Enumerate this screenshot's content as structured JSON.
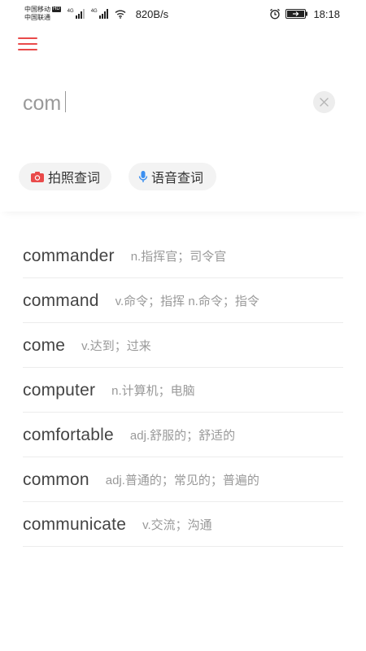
{
  "status_bar": {
    "carrier_1": "中国移动",
    "carrier_2": "中国联通",
    "hd_badge": "HD",
    "network_tag_1": "4G",
    "network_tag_2": "4G",
    "net_speed": "820B/s",
    "alarm_icon": "alarm-clock-icon",
    "battery_icon": "battery-icon",
    "time": "18:18"
  },
  "header": {
    "menu_icon": "hamburger-menu-icon",
    "menu_color": "#e94a4a"
  },
  "search": {
    "value": "com",
    "clear_icon": "clear-x-icon"
  },
  "actions": {
    "photo_label": "拍照查词",
    "photo_icon": "camera-icon",
    "photo_icon_color": "#e94a4a",
    "voice_label": "语音查词",
    "voice_icon": "microphone-icon",
    "voice_icon_color": "#3b8ff0"
  },
  "results": [
    {
      "word": "commander",
      "meaning": "n.指挥官；司令官"
    },
    {
      "word": "command",
      "meaning": "v.命令；指挥 n.命令；指令"
    },
    {
      "word": "come",
      "meaning": "v.达到；过来"
    },
    {
      "word": "computer",
      "meaning": "n.计算机；电脑"
    },
    {
      "word": "comfortable",
      "meaning": "adj.舒服的；舒适的"
    },
    {
      "word": "common",
      "meaning": "adj.普通的；常见的；普遍的"
    },
    {
      "word": "communicate",
      "meaning": "v.交流；沟通"
    }
  ]
}
